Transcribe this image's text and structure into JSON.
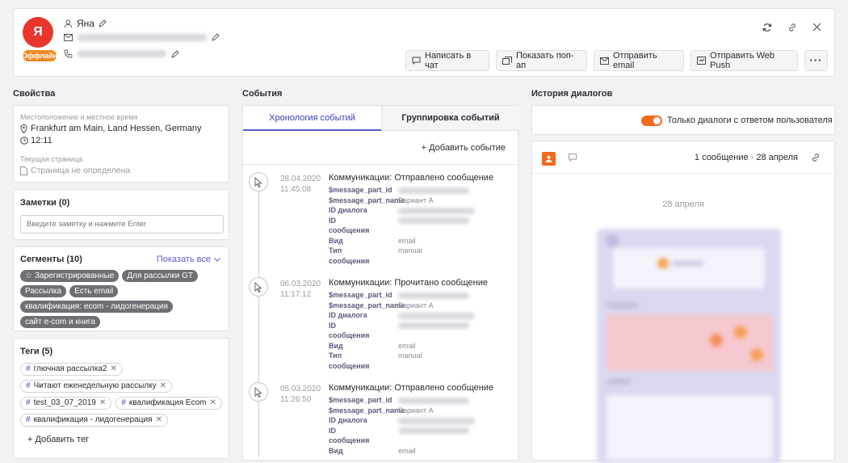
{
  "profile": {
    "avatar_letter": "Я",
    "name": "Яна",
    "status_badge": "Оффлайн",
    "colors": {
      "avatar": "#e8362f",
      "badge": "#f08a24",
      "accent": "#5b5bd6"
    }
  },
  "actions": {
    "write_chat": "Написать в чат",
    "show_popup": "Показать поп-ап",
    "send_email": "Отправить email",
    "send_web_push": "Отправить Web Push"
  },
  "properties": {
    "title": "Свойства",
    "location_label": "Местоположение и местное время",
    "location_value": "Frankfurt am Main, Land Hessen, Germany",
    "local_time": "12:11",
    "page_label": "Текущая страница",
    "page_value": "Страница не определена"
  },
  "notes": {
    "title": "Заметки (0)",
    "placeholder": "Введите заметку и нажмите Enter"
  },
  "segments": {
    "title": "Сегменты (10)",
    "show_all": "Показать все",
    "items": [
      "Зарегистрированные",
      "Для рассылки GT",
      "Рассылка",
      "Есть email",
      "квалификация: ecom - лидогенерация",
      "сайт e-com и книга"
    ]
  },
  "tags": {
    "title": "Теги (5)",
    "items": [
      "глючная рассылка2",
      "Читают еженедельную рассылку",
      "test_03_07_2019",
      "квалификация Ecom",
      "квалификация - лидогенерация"
    ],
    "add_label": "+ Добавить тег"
  },
  "events": {
    "title": "События",
    "tab_timeline": "Хронология событий",
    "tab_grouping": "Группировка событий",
    "add_event": "+ Добавить событие",
    "items": [
      {
        "date": "28.04.2020",
        "time": "11:45:08",
        "title": "Коммуникации: Отправлено сообщение",
        "keys": [
          "$message_part_id",
          "$message_part_name",
          "ID диалога",
          "ID",
          "сообщения",
          "Вид",
          "Тип",
          "сообщения"
        ],
        "vals": [
          "",
          "Вариант А",
          "",
          "",
          "",
          "email",
          "manual",
          ""
        ]
      },
      {
        "date": "06.03.2020",
        "time": "11:17:12",
        "title": "Коммуникации: Прочитано сообщение",
        "keys": [
          "$message_part_id",
          "$message_part_name",
          "ID диалога",
          "ID",
          "сообщения",
          "Вид",
          "Тип",
          "сообщения"
        ],
        "vals": [
          "",
          "Вариант А",
          "",
          "",
          "",
          "email",
          "manual",
          ""
        ]
      },
      {
        "date": "05.03.2020",
        "time": "11:26:50",
        "title": "Коммуникации: Отправлено сообщение",
        "keys": [
          "$message_part_id",
          "$message_part_name",
          "ID диалога",
          "ID",
          "сообщения",
          "Вид"
        ],
        "vals": [
          "",
          "Вариант А",
          "",
          "",
          "",
          "email"
        ]
      }
    ]
  },
  "history": {
    "title": "История диалогов",
    "toggle_label": "Только диалоги с ответом пользователя",
    "summary": "1 сообщение · 28 апреля",
    "date_divider": "28 апреля"
  }
}
